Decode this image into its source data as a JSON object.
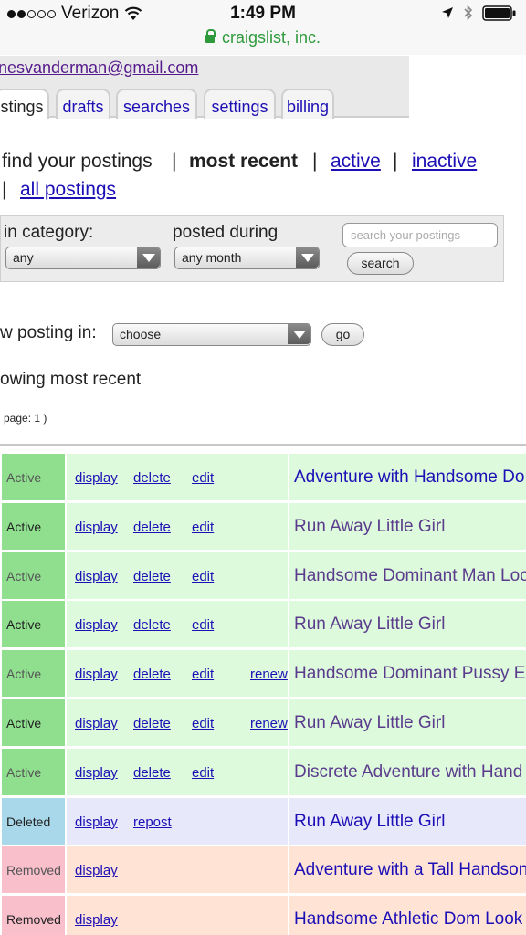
{
  "status_bar": {
    "carrier": "Verizon",
    "time": "1:49 PM",
    "url": "craigslist, inc."
  },
  "account": {
    "email": "nesvanderman@gmail.com"
  },
  "tabs": [
    {
      "label": "stings"
    },
    {
      "label": "drafts"
    },
    {
      "label": "searches"
    },
    {
      "label": "settings"
    },
    {
      "label": "billing"
    }
  ],
  "posting_nav": {
    "prefix": "find your postings",
    "sep": "|",
    "current": "most recent",
    "active": "active",
    "inactive": "inactive",
    "all": "all postings"
  },
  "filter": {
    "category_label": "in category:",
    "category_value": "any",
    "posted_label": "posted during",
    "posted_value": "any month",
    "search_placeholder": "search your postings",
    "search_button": "search"
  },
  "new_posting": {
    "label": "w posting in:",
    "select_value": "choose",
    "go_button": "go"
  },
  "showing_text": "owing most recent",
  "page_text": "page: 1 )",
  "colors": {
    "active_status": "#8fdf8f",
    "active_row": "#ddfadd",
    "deleted_status": "#a8d8ea",
    "deleted_row": "#e8e8fb",
    "removed_status": "#f9c0cb",
    "removed_row": "#ffe4d6",
    "link": "#1c0fb5"
  },
  "postings": [
    {
      "status": "Active",
      "actions": [
        "display",
        "delete",
        "edit"
      ],
      "title": "Adventure with Handsome Do",
      "title_style": "blue"
    },
    {
      "status": "Active",
      "actions": [
        "display",
        "delete",
        "edit"
      ],
      "title": "Run Away Little Girl",
      "title_style": "purple"
    },
    {
      "status": "Active",
      "actions": [
        "display",
        "delete",
        "edit"
      ],
      "title": "Handsome Dominant Man Loo",
      "title_style": "purple"
    },
    {
      "status": "Active",
      "actions": [
        "display",
        "delete",
        "edit"
      ],
      "title": "Run Away Little Girl",
      "title_style": "purple"
    },
    {
      "status": "Active",
      "actions": [
        "display",
        "delete",
        "edit",
        "renew"
      ],
      "title": "Handsome Dominant Pussy E",
      "title_style": "purple"
    },
    {
      "status": "Active",
      "actions": [
        "display",
        "delete",
        "edit",
        "renew"
      ],
      "title": "Run Away Little Girl",
      "title_style": "purple"
    },
    {
      "status": "Active",
      "actions": [
        "display",
        "delete",
        "edit"
      ],
      "title": "Discrete Adventure with Hand",
      "title_style": "purple"
    },
    {
      "status": "Deleted",
      "actions": [
        "display",
        "repost"
      ],
      "title": "Run Away Little Girl",
      "title_style": "blue"
    },
    {
      "status": "Removed",
      "actions": [
        "display"
      ],
      "title": "Adventure with a Tall Handson",
      "title_style": "blue"
    },
    {
      "status": "Removed",
      "actions": [
        "display"
      ],
      "title": "Handsome Athletic Dom Look",
      "title_style": "blue"
    }
  ]
}
